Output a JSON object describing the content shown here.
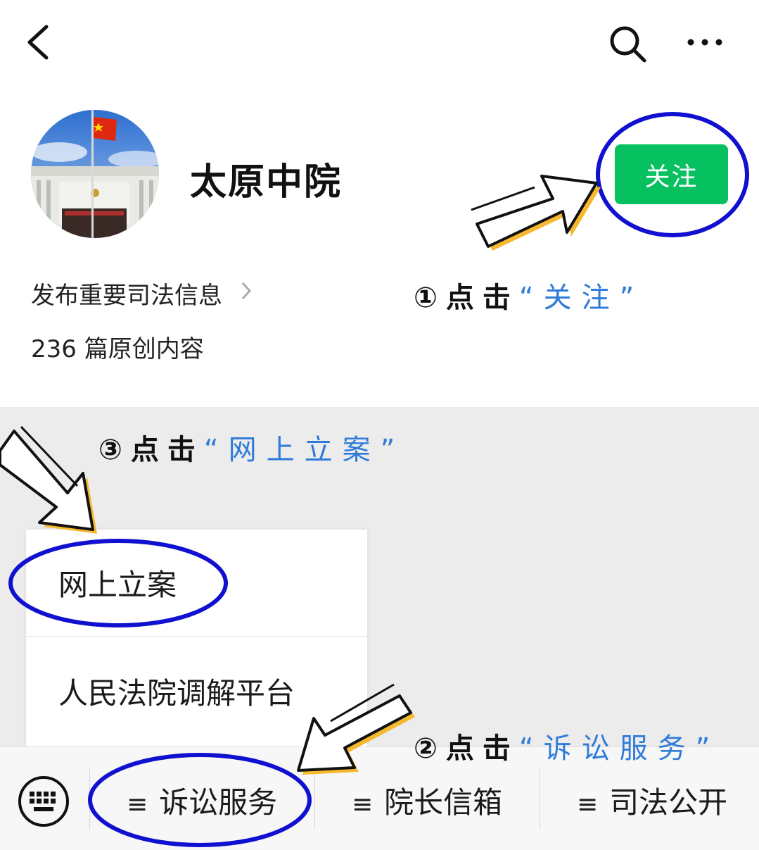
{
  "account": {
    "name": "太原中院",
    "description": "发布重要司法信息",
    "article_count": "236 篇原创内容",
    "follow_label": "关注"
  },
  "annotations": {
    "step1_prefix": "①点击",
    "step1_quote": "“关注”",
    "step2_prefix": "②点击",
    "step2_quote": "“诉讼服务”",
    "step3_prefix": "③点击",
    "step3_quote": "“网上立案”"
  },
  "submenu": {
    "items": [
      {
        "label": "网上立案"
      },
      {
        "label": "人民法院调解平台"
      }
    ]
  },
  "menu": {
    "burger": "≡",
    "items": [
      {
        "label": "诉讼服务"
      },
      {
        "label": "院长信箱"
      },
      {
        "label": "司法公开"
      }
    ]
  },
  "colors": {
    "follow_button": "#07c160",
    "annotation_circle": "#1010d0",
    "annotation_highlight": "#2f7bd9",
    "arrow_shadow": "#f5b82e"
  },
  "icons": {
    "back": "chevron-left-icon",
    "search": "search-icon",
    "more": "more-dots-icon",
    "keyboard": "keyboard-icon"
  }
}
